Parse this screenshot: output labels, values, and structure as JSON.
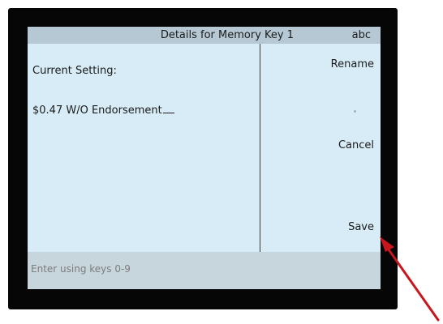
{
  "header": {
    "title": "Details for Memory Key 1",
    "input_mode": "abc"
  },
  "main": {
    "field_label": "Current Setting:",
    "field_value": "$0.47 W/O Endorsement"
  },
  "softkeys": {
    "rename": "Rename",
    "cancel": "Cancel",
    "save": "Save"
  },
  "status": {
    "hint": "Enter using keys 0-9"
  },
  "colors": {
    "screen_bg": "#d7ecf6",
    "title_bar": "#b5c8d3",
    "annotation_arrow": "#c8161e"
  }
}
